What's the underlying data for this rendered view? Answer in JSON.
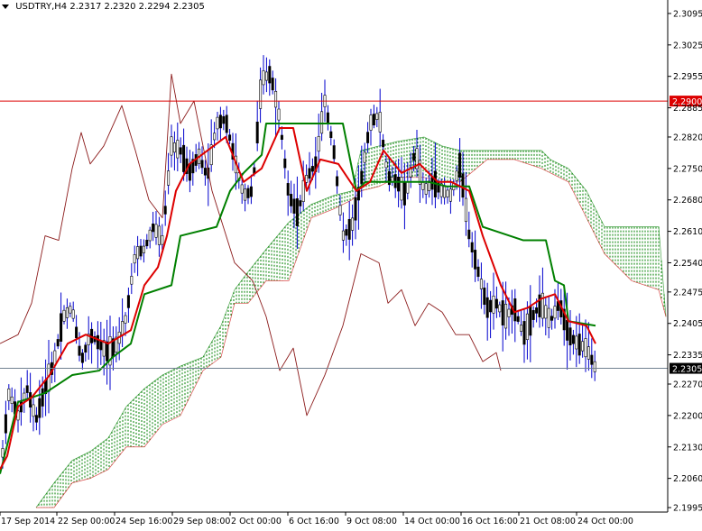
{
  "header": {
    "symbol": "USDTRY,H4",
    "ohlc": "2.2317 2.2320 2.2294 2.2305"
  },
  "chart_data": {
    "type": "candlestick",
    "title": "USDTRY,H4",
    "ylim": [
      2.1985,
      2.3125
    ],
    "price_ticks": [
      "2.3095",
      "2.3025",
      "2.2955",
      "2.2885",
      "2.2820",
      "2.2750",
      "2.2680",
      "2.2610",
      "2.2540",
      "2.2475",
      "2.2405",
      "2.2335",
      "2.2270",
      "2.2200",
      "2.2130",
      "2.2060",
      "2.1995"
    ],
    "time_labels": [
      "17 Sep 2014",
      "22 Sep 00:00",
      "24 Sep 16:00",
      "29 Sep 08:00",
      "2 Oct 00:00",
      "6 Oct 16:00",
      "9 Oct 08:00",
      "14 Oct 00:00",
      "16 Oct 16:00",
      "21 Oct 08:00",
      "24 Oct 00:00"
    ],
    "hlines": [
      {
        "value": 2.29,
        "label": "2.2900",
        "color": "#dd0000"
      },
      {
        "value": 2.2305,
        "label": "2.2305",
        "color": "#708090"
      }
    ],
    "colors": {
      "candles": "#0000cc",
      "tenkan": "#dd0000",
      "kijun": "#008000",
      "chikou": "#8b1a1a",
      "cloud_bull": "#008000",
      "cloud_bear": "#cc0000"
    },
    "series": [
      {
        "name": "tenkan",
        "points": [
          [
            0,
            2.208
          ],
          [
            8,
            2.211
          ],
          [
            20,
            2.222
          ],
          [
            35,
            2.224
          ],
          [
            55,
            2.229
          ],
          [
            75,
            2.236
          ],
          [
            95,
            2.238
          ],
          [
            120,
            2.236
          ],
          [
            145,
            2.239
          ],
          [
            160,
            2.249
          ],
          [
            175,
            2.253
          ],
          [
            185,
            2.26
          ],
          [
            195,
            2.27
          ],
          [
            210,
            2.276
          ],
          [
            230,
            2.279
          ],
          [
            250,
            2.282
          ],
          [
            270,
            2.272
          ],
          [
            290,
            2.275
          ],
          [
            310,
            2.284
          ],
          [
            325,
            2.284
          ],
          [
            340,
            2.27
          ],
          [
            355,
            2.277
          ],
          [
            375,
            2.276
          ],
          [
            395,
            2.27
          ],
          [
            410,
            2.272
          ],
          [
            425,
            2.279
          ],
          [
            445,
            2.274
          ],
          [
            465,
            2.276
          ],
          [
            485,
            2.272
          ],
          [
            500,
            2.272
          ],
          [
            520,
            2.27
          ],
          [
            535,
            2.26
          ],
          [
            555,
            2.249
          ],
          [
            570,
            2.243
          ],
          [
            585,
            2.244
          ],
          [
            600,
            2.246
          ],
          [
            615,
            2.247
          ],
          [
            630,
            2.241
          ],
          [
            650,
            2.24
          ],
          [
            660,
            2.236
          ]
        ]
      },
      {
        "name": "kijun",
        "points": [
          [
            0,
            2.207
          ],
          [
            20,
            2.223
          ],
          [
            50,
            2.225
          ],
          [
            80,
            2.229
          ],
          [
            110,
            2.23
          ],
          [
            125,
            2.233
          ],
          [
            145,
            2.236
          ],
          [
            160,
            2.247
          ],
          [
            190,
            2.249
          ],
          [
            200,
            2.26
          ],
          [
            240,
            2.262
          ],
          [
            255,
            2.27
          ],
          [
            270,
            2.274
          ],
          [
            290,
            2.278
          ],
          [
            295,
            2.285
          ],
          [
            335,
            2.285
          ],
          [
            380,
            2.285
          ],
          [
            395,
            2.27
          ],
          [
            405,
            2.272
          ],
          [
            460,
            2.272
          ],
          [
            475,
            2.272
          ],
          [
            495,
            2.271
          ],
          [
            520,
            2.271
          ],
          [
            535,
            2.262
          ],
          [
            580,
            2.259
          ],
          [
            605,
            2.259
          ],
          [
            615,
            2.25
          ],
          [
            625,
            2.249
          ],
          [
            630,
            2.241
          ],
          [
            660,
            2.24
          ]
        ]
      },
      {
        "name": "chikou",
        "points": [
          [
            0,
            2.236
          ],
          [
            20,
            2.238
          ],
          [
            35,
            2.245
          ],
          [
            50,
            2.26
          ],
          [
            65,
            2.259
          ],
          [
            80,
            2.275
          ],
          [
            90,
            2.283
          ],
          [
            100,
            2.276
          ],
          [
            115,
            2.28
          ],
          [
            135,
            2.289
          ],
          [
            150,
            2.279
          ],
          [
            165,
            2.268
          ],
          [
            180,
            2.264
          ],
          [
            190,
            2.296
          ],
          [
            200,
            2.285
          ],
          [
            215,
            2.29
          ],
          [
            235,
            2.27
          ],
          [
            260,
            2.254
          ],
          [
            280,
            2.25
          ],
          [
            295,
            2.242
          ],
          [
            310,
            2.23
          ],
          [
            325,
            2.235
          ],
          [
            340,
            2.22
          ],
          [
            360,
            2.229
          ],
          [
            380,
            2.24
          ],
          [
            400,
            2.256
          ],
          [
            420,
            2.254
          ],
          [
            430,
            2.245
          ],
          [
            445,
            2.248
          ],
          [
            460,
            2.24
          ],
          [
            475,
            2.245
          ],
          [
            490,
            2.243
          ],
          [
            505,
            2.238
          ],
          [
            520,
            2.238
          ],
          [
            535,
            2.232
          ],
          [
            550,
            2.234
          ],
          [
            555,
            2.23
          ]
        ]
      },
      {
        "name": "senkou_a",
        "points": [
          [
            40,
            2.1995
          ],
          [
            60,
            2.205
          ],
          [
            80,
            2.21
          ],
          [
            100,
            2.212
          ],
          [
            120,
            2.215
          ],
          [
            140,
            2.222
          ],
          [
            160,
            2.226
          ],
          [
            180,
            2.229
          ],
          [
            200,
            2.231
          ],
          [
            225,
            2.233
          ],
          [
            245,
            2.24
          ],
          [
            260,
            2.248
          ],
          [
            275,
            2.252
          ],
          [
            295,
            2.257
          ],
          [
            320,
            2.263
          ],
          [
            345,
            2.267
          ],
          [
            370,
            2.269
          ],
          [
            390,
            2.27
          ],
          [
            400,
            2.279
          ],
          [
            420,
            2.28
          ],
          [
            440,
            2.281
          ],
          [
            470,
            2.282
          ],
          [
            490,
            2.28
          ],
          [
            510,
            2.279
          ],
          [
            540,
            2.279
          ],
          [
            570,
            2.279
          ],
          [
            600,
            2.279
          ],
          [
            610,
            2.277
          ],
          [
            630,
            2.275
          ],
          [
            650,
            2.27
          ],
          [
            670,
            2.262
          ],
          [
            700,
            2.262
          ],
          [
            730,
            2.262
          ],
          [
            738,
            2.242
          ]
        ]
      },
      {
        "name": "senkou_b",
        "points": [
          [
            40,
            2.1995
          ],
          [
            60,
            2.1995
          ],
          [
            80,
            2.205
          ],
          [
            100,
            2.206
          ],
          [
            120,
            2.208
          ],
          [
            140,
            2.213
          ],
          [
            160,
            2.213
          ],
          [
            180,
            2.218
          ],
          [
            200,
            2.22
          ],
          [
            225,
            2.23
          ],
          [
            245,
            2.233
          ],
          [
            260,
            2.245
          ],
          [
            275,
            2.245
          ],
          [
            295,
            2.25
          ],
          [
            320,
            2.25
          ],
          [
            345,
            2.264
          ],
          [
            370,
            2.266
          ],
          [
            390,
            2.268
          ],
          [
            400,
            2.27
          ],
          [
            420,
            2.271
          ],
          [
            440,
            2.273
          ],
          [
            470,
            2.273
          ],
          [
            490,
            2.272
          ],
          [
            510,
            2.272
          ],
          [
            540,
            2.277
          ],
          [
            570,
            2.277
          ],
          [
            600,
            2.275
          ],
          [
            610,
            2.274
          ],
          [
            630,
            2.272
          ],
          [
            650,
            2.264
          ],
          [
            670,
            2.256
          ],
          [
            700,
            2.25
          ],
          [
            730,
            2.248
          ],
          [
            738,
            2.242
          ]
        ]
      }
    ],
    "candles_path": [
      [
        0,
        2.206
      ],
      [
        10,
        2.225
      ],
      [
        20,
        2.22
      ],
      [
        30,
        2.226
      ],
      [
        40,
        2.219
      ],
      [
        50,
        2.226
      ],
      [
        60,
        2.232
      ],
      [
        70,
        2.242
      ],
      [
        80,
        2.244
      ],
      [
        90,
        2.232
      ],
      [
        100,
        2.238
      ],
      [
        110,
        2.236
      ],
      [
        120,
        2.234
      ],
      [
        130,
        2.236
      ],
      [
        140,
        2.242
      ],
      [
        150,
        2.256
      ],
      [
        160,
        2.257
      ],
      [
        170,
        2.262
      ],
      [
        180,
        2.259
      ],
      [
        190,
        2.28
      ],
      [
        200,
        2.279
      ],
      [
        210,
        2.274
      ],
      [
        220,
        2.278
      ],
      [
        230,
        2.273
      ],
      [
        240,
        2.285
      ],
      [
        250,
        2.286
      ],
      [
        260,
        2.277
      ],
      [
        270,
        2.269
      ],
      [
        280,
        2.27
      ],
      [
        290,
        2.295
      ],
      [
        300,
        2.296
      ],
      [
        310,
        2.286
      ],
      [
        320,
        2.269
      ],
      [
        330,
        2.265
      ],
      [
        340,
        2.273
      ],
      [
        350,
        2.276
      ],
      [
        360,
        2.29
      ],
      [
        370,
        2.279
      ],
      [
        380,
        2.26
      ],
      [
        390,
        2.262
      ],
      [
        400,
        2.272
      ],
      [
        410,
        2.285
      ],
      [
        420,
        2.287
      ],
      [
        430,
        2.273
      ],
      [
        440,
        2.272
      ],
      [
        450,
        2.269
      ],
      [
        460,
        2.279
      ],
      [
        470,
        2.27
      ],
      [
        480,
        2.272
      ],
      [
        490,
        2.27
      ],
      [
        500,
        2.269
      ],
      [
        510,
        2.276
      ],
      [
        520,
        2.26
      ],
      [
        530,
        2.252
      ],
      [
        540,
        2.244
      ],
      [
        550,
        2.245
      ],
      [
        560,
        2.242
      ],
      [
        570,
        2.244
      ],
      [
        580,
        2.238
      ],
      [
        590,
        2.242
      ],
      [
        600,
        2.245
      ],
      [
        610,
        2.241
      ],
      [
        620,
        2.245
      ],
      [
        630,
        2.238
      ],
      [
        640,
        2.236
      ],
      [
        650,
        2.235
      ],
      [
        660,
        2.2305
      ]
    ]
  }
}
